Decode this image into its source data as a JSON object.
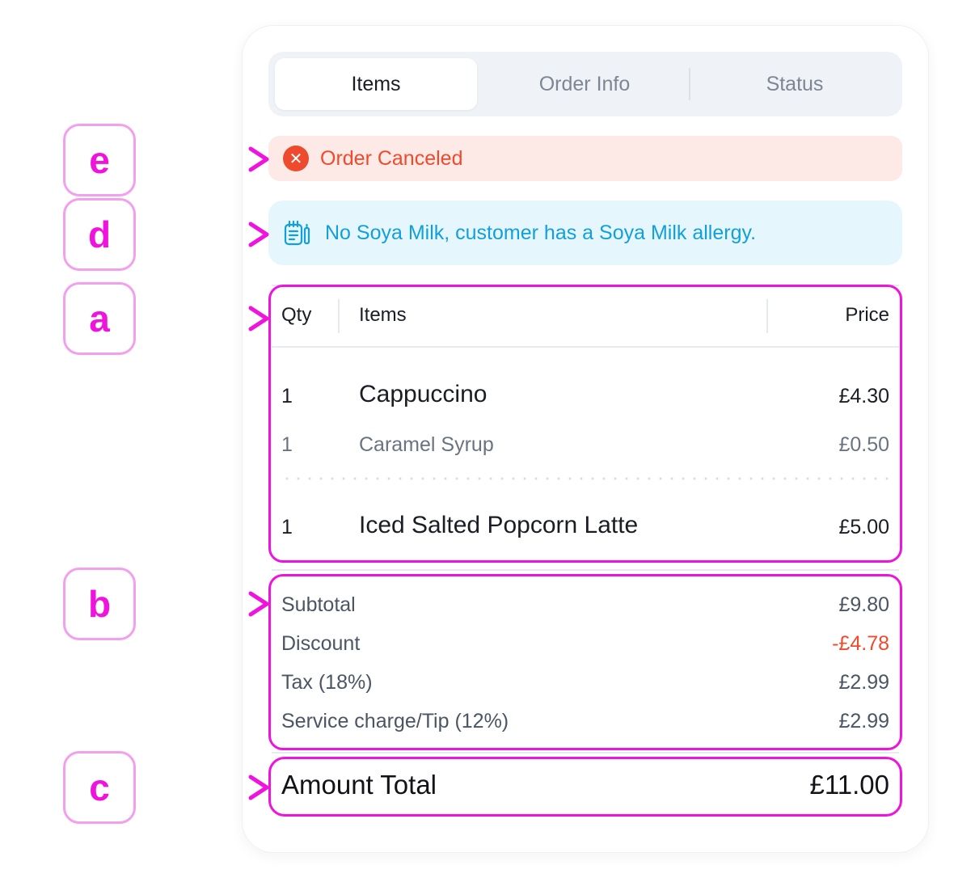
{
  "tabs": [
    {
      "label": "Items"
    },
    {
      "label": "Order Info"
    },
    {
      "label": "Status"
    }
  ],
  "alert": {
    "text": "Order Canceled",
    "icon": "x-circle-icon"
  },
  "note": {
    "text": "No Soya Milk, customer has a Soya Milk allergy.",
    "icon": "clipboard-note-icon"
  },
  "table": {
    "headers": {
      "qty": "Qty",
      "items": "Items",
      "price": "Price"
    },
    "rows": [
      {
        "qty": "1",
        "name": "Cappuccino",
        "price": "£4.30"
      },
      {
        "qty": "1",
        "name": "Caramel Syrup",
        "price": "£0.50"
      },
      {
        "qty": "1",
        "name": "Iced Salted Popcorn Latte",
        "price": "£5.00"
      }
    ]
  },
  "summary": {
    "subtotal": {
      "label": "Subtotal",
      "value": "£9.80"
    },
    "discount": {
      "label": "Discount",
      "value": "-£4.78"
    },
    "tax": {
      "label": "Tax (18%)",
      "value": "£2.99"
    },
    "service": {
      "label": "Service charge/Tip (12%)",
      "value": "£2.99"
    }
  },
  "total": {
    "label": "Amount Total",
    "value": "£11.00"
  },
  "annotations": [
    "e",
    "d",
    "a",
    "b",
    "c"
  ],
  "colors": {
    "highlight": "#f013dd",
    "danger": "#ef4a2c",
    "info": "#129fdc"
  }
}
